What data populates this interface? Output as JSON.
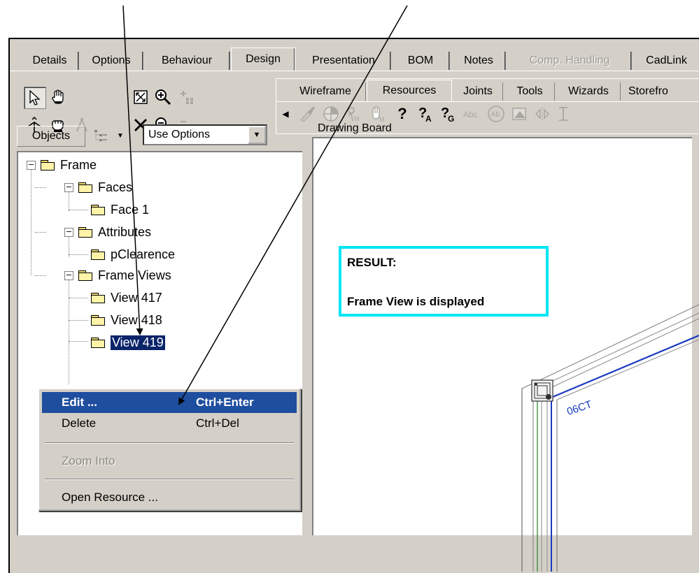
{
  "main_tabs": [
    {
      "label": "Details",
      "state": "normal"
    },
    {
      "label": "Options",
      "state": "normal"
    },
    {
      "label": "Behaviour",
      "state": "normal"
    },
    {
      "label": "Design",
      "state": "active"
    },
    {
      "label": "Presentation",
      "state": "normal"
    },
    {
      "label": "BOM",
      "state": "normal"
    },
    {
      "label": "Notes",
      "state": "normal"
    },
    {
      "label": "Comp. Handling",
      "state": "disabled"
    },
    {
      "label": "CadLink",
      "state": "normal"
    }
  ],
  "sub_tabs": [
    {
      "label": "Wireframe",
      "state": "normal"
    },
    {
      "label": "Resources",
      "state": "active"
    },
    {
      "label": "Joints",
      "state": "normal"
    },
    {
      "label": "Tools",
      "state": "normal"
    },
    {
      "label": "Wizards",
      "state": "normal"
    },
    {
      "label": "Storefro",
      "state": "normal"
    }
  ],
  "objects_panel": {
    "label": "Objects",
    "combo_value": "Use Options"
  },
  "tree": {
    "frame": "Frame",
    "faces": "Faces",
    "face1": "Face 1",
    "attributes": "Attributes",
    "clearence": "pClearence",
    "frame_views": "Frame Views",
    "view417": "View 417",
    "view418": "View 418",
    "view419": "View 419"
  },
  "context_menu": {
    "edit": {
      "label": "Edit ...",
      "shortcut": "Ctrl+Enter"
    },
    "delete": {
      "label": "Delete",
      "shortcut": "Ctrl+Del"
    },
    "zoom": {
      "label": "Zoom Into"
    },
    "open_resource": {
      "label": "Open Resource ..."
    }
  },
  "drawing_board": {
    "title": "Drawing Board",
    "result_title": "RESULT:",
    "result_text": "Frame View is displayed",
    "frame_label": "06CT"
  },
  "colors": {
    "selection": "#0a246a",
    "menu_highlight": "#1f4e9f",
    "result_border": "#00e5f5",
    "frame_line": "#1a3bbf"
  }
}
